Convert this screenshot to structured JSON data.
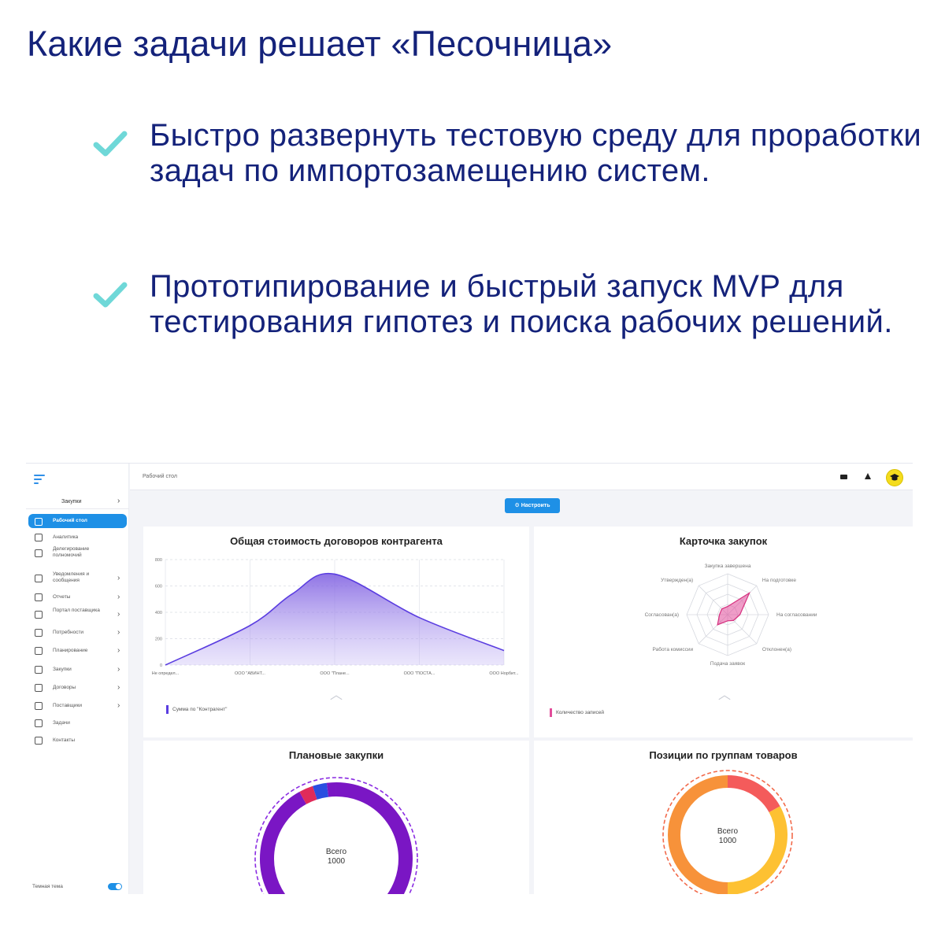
{
  "slide": {
    "title": "Какие задачи решает «Песочница»",
    "bullets": [
      "Быстро развернуть тестовую среду для проработки задач по импортозамещению систем.",
      "Прототипирование и быстрый запуск MVP для тестирования гипотез и поиска рабочих решений."
    ],
    "bullet_icon": "checkmark-icon",
    "colors": {
      "text": "#14227a",
      "check": "#6fd8d8"
    }
  },
  "app": {
    "sidebar": {
      "section": "Закупки",
      "items": [
        {
          "label": "Рабочий стол",
          "icon": "desktop-icon",
          "active": true,
          "chevron": false
        },
        {
          "label": "Аналитика",
          "icon": "analytics-icon",
          "active": false,
          "chevron": false
        },
        {
          "label": "Делегирование полномочий",
          "icon": "delegation-icon",
          "active": false,
          "chevron": false
        },
        {
          "label": "Уведомления и сообщения",
          "icon": "mail-icon",
          "active": false,
          "chevron": true
        },
        {
          "label": "Отчеты",
          "icon": "report-icon",
          "active": false,
          "chevron": true
        },
        {
          "label": "Портал поставщика",
          "icon": "truck-icon",
          "active": false,
          "chevron": true
        },
        {
          "label": "Потребности",
          "icon": "cart-icon",
          "active": false,
          "chevron": true
        },
        {
          "label": "Планирование",
          "icon": "calendar-icon",
          "active": false,
          "chevron": true
        },
        {
          "label": "Закупки",
          "icon": "car-icon",
          "active": false,
          "chevron": true
        },
        {
          "label": "Договоры",
          "icon": "document-icon",
          "active": false,
          "chevron": true
        },
        {
          "label": "Поставщики",
          "icon": "location-icon",
          "active": false,
          "chevron": true
        },
        {
          "label": "Задачи",
          "icon": "task-icon",
          "active": false,
          "chevron": false
        },
        {
          "label": "Контакты",
          "icon": "contacts-icon",
          "active": false,
          "chevron": false
        }
      ],
      "dark_theme_label": "Темная тема",
      "dark_theme_on": true
    },
    "topbar": {
      "breadcrumb": "Рабочий стол"
    },
    "configure_button": "Настроить",
    "accent": "#1e90e6"
  },
  "chart_data": [
    {
      "type": "area",
      "title": "Общая стоимость договоров контрагента",
      "categories": [
        "Не определ...",
        "ООО \"АВИНТ...",
        "ООО \"Плане...",
        "ООО \"ПОСТА...",
        "ООО Норбит..."
      ],
      "x": [
        0,
        1,
        1.5,
        2,
        3,
        4
      ],
      "series": [
        {
          "name": "Сумма по \"Контрагент\"",
          "values": [
            0,
            300,
            540,
            690,
            360,
            110
          ],
          "color": "#7b5be0"
        }
      ],
      "y_ticks": [
        0,
        200,
        400,
        600,
        800
      ],
      "ylim": [
        0,
        800
      ],
      "grid": true,
      "legend_position": "bottom-left"
    },
    {
      "type": "radar",
      "title": "Карточка закупок",
      "axes": [
        "Закупка завершена",
        "На подготовке",
        "На согласовании",
        "Отклонен(а)",
        "Подача заявок",
        "Работа комиссии",
        "Согласован(а)",
        "Утвержден(а)"
      ],
      "series": [
        {
          "name": "Количество записей",
          "values": [
            0.2,
            0.75,
            0.3,
            0.2,
            0.15,
            0.35,
            0.2,
            0.2
          ],
          "color": "#e24c9a"
        }
      ],
      "legend_position": "bottom-left"
    },
    {
      "type": "donut",
      "title": "Плановые закупки",
      "center_label": "Всего",
      "total": 1000,
      "slices": [
        {
          "share": 0.92,
          "color": "#7a16c4"
        },
        {
          "share": 0.03,
          "color": "#e02b5a"
        },
        {
          "share": 0.03,
          "color": "#2a4ee0"
        },
        {
          "share": 0.02,
          "color": "#7a16c4"
        }
      ]
    },
    {
      "type": "donut",
      "title": "Позиции по группам товаров",
      "center_label": "Всего",
      "total": 1000,
      "slices": [
        {
          "share": 0.17,
          "color": "#f45b5b"
        },
        {
          "share": 0.33,
          "color": "#fdc132"
        },
        {
          "share": 0.5,
          "color": "#f7923a"
        }
      ]
    }
  ]
}
